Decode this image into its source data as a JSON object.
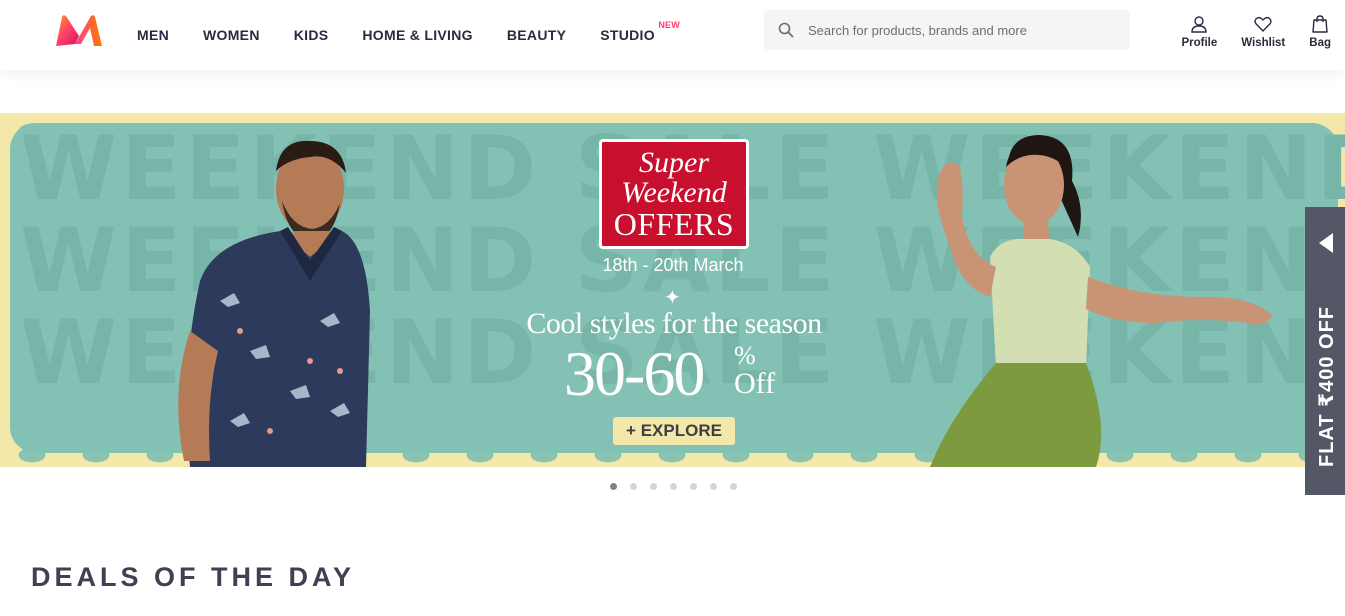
{
  "header": {
    "nav": [
      "MEN",
      "WOMEN",
      "KIDS",
      "HOME & LIVING",
      "BEAUTY",
      "STUDIO"
    ],
    "studio_badge": "NEW",
    "search_placeholder": "Search for products, brands and more",
    "actions": {
      "profile": "Profile",
      "wishlist": "Wishlist",
      "bag": "Bag"
    }
  },
  "banner": {
    "watermark": "WEEKEND SALE WEEKEND SALE",
    "offer_line1": "Super",
    "offer_line2": "Weekend",
    "offer_line3": "OFFERS",
    "dates": "18th - 20th March",
    "tagline": "Cool styles for the season",
    "discount": "30-60",
    "discount_pct": "%",
    "discount_off": "Off",
    "cta": "+ EXPLORE"
  },
  "side_tab": {
    "label": "FLAT ₹400 OFF"
  },
  "carousel": {
    "total": 7,
    "active": 1
  },
  "section": {
    "title": "DEALS OF THE DAY"
  },
  "colors": {
    "accent": "#ff3f6c",
    "banner_teal": "#84c1b5",
    "banner_yellow": "#f3e8a9",
    "offer_red": "#c8102e",
    "side_tab": "#535766"
  }
}
